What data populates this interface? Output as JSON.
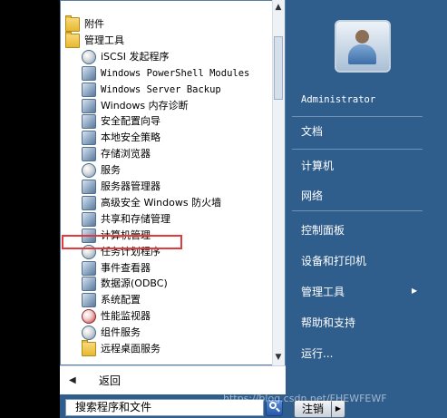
{
  "programs": [
    {
      "label": "附件",
      "icon": "folder-icon",
      "mono": false
    },
    {
      "label": "管理工具",
      "icon": "folder-icon",
      "mono": false
    },
    {
      "label": "iSCSI 发起程序",
      "icon": "globe-icon",
      "mono": false
    },
    {
      "label": "Windows PowerShell Modules",
      "icon": "powershell-icon",
      "mono": true
    },
    {
      "label": "Windows Server Backup",
      "icon": "backup-icon",
      "mono": true
    },
    {
      "label": "Windows 内存诊断",
      "icon": "memory-icon",
      "mono": false
    },
    {
      "label": "安全配置向导",
      "icon": "security-wizard-icon",
      "mono": false
    },
    {
      "label": "本地安全策略",
      "icon": "lock-icon",
      "mono": false
    },
    {
      "label": "存储浏览器",
      "icon": "storage-icon",
      "mono": false
    },
    {
      "label": "服务",
      "icon": "gear-icon",
      "mono": false
    },
    {
      "label": "服务器管理器",
      "icon": "server-icon",
      "mono": false
    },
    {
      "label": "高级安全 Windows 防火墙",
      "icon": "firewall-icon",
      "mono": false
    },
    {
      "label": "共享和存储管理",
      "icon": "share-icon",
      "mono": false
    },
    {
      "label": "计算机管理",
      "icon": "computer-management-icon",
      "mono": false
    },
    {
      "label": "任务计划程序",
      "icon": "clock-icon",
      "mono": false
    },
    {
      "label": "事件查看器",
      "icon": "event-viewer-icon",
      "mono": false
    },
    {
      "label": "数据源(ODBC)",
      "icon": "database-icon",
      "mono": false
    },
    {
      "label": "系统配置",
      "icon": "system-config-icon",
      "mono": false
    },
    {
      "label": "性能监视器",
      "icon": "performance-icon",
      "mono": false
    },
    {
      "label": "组件服务",
      "icon": "component-icon",
      "mono": false
    },
    {
      "label": "远程桌面服务",
      "icon": "folder-icon",
      "mono": false
    }
  ],
  "back_label": "返回",
  "search_placeholder": "搜索程序和文件",
  "right_menu": {
    "username": "Administrator",
    "documents": "文档",
    "computer": "计算机",
    "network": "网络",
    "control_panel": "控制面板",
    "devices_printers": "设备和打印机",
    "admin_tools": "管理工具",
    "help_support": "帮助和支持",
    "run": "运行..."
  },
  "shutdown_label": "注销",
  "watermark": "https://blog.csdn.net/FHEWFEWF",
  "colors": {
    "highlight_border": "#e23b3b",
    "menu_blue": "#2f5d8c"
  }
}
